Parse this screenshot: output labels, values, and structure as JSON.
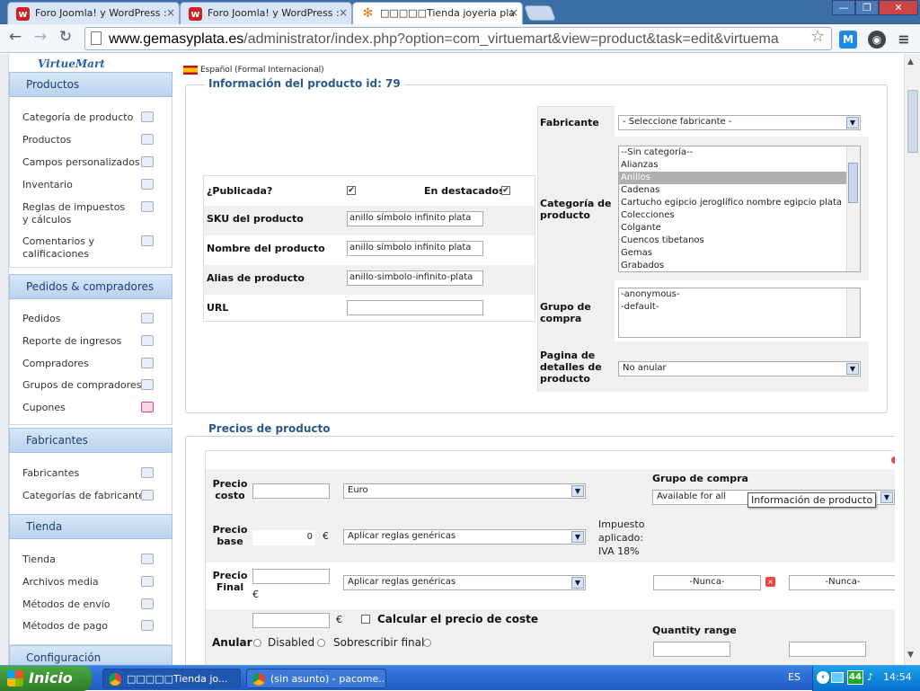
{
  "browser": {
    "tabs": [
      {
        "label": "Foro Joomla! y WordPress :",
        "icon": "w-favicon"
      },
      {
        "label": "Foro Joomla! y WordPress :",
        "icon": "w-favicon"
      },
      {
        "label": "□□□□□Tienda joyeria pla",
        "icon": "joomla-favicon"
      }
    ],
    "url_domain": "www.gemasyplata.es",
    "url_path": "/administrator/index.php?option=com_virtuemart&view=product&task=edit&virtuema"
  },
  "sidebar": {
    "logo": "VirtueMart",
    "sections": [
      {
        "title": "Productos",
        "items": [
          "Categoría de producto",
          "Productos",
          "Campos personalizados",
          "Inventario",
          "Reglas de impuestos y cálculos",
          "Comentarios y calificaciones"
        ]
      },
      {
        "title": "Pedidos & compradores",
        "items": [
          "Pedidos",
          "Reporte de ingresos",
          "Compradores",
          "Grupos de compradores",
          "Cupones"
        ]
      },
      {
        "title": "Fabricantes",
        "items": [
          "Fabricantes",
          "Categorías de fabricante"
        ]
      },
      {
        "title": "Tienda",
        "items": [
          "Tienda",
          "Archivos media",
          "Métodos de envío",
          "Métodos de pago"
        ]
      },
      {
        "title": "Configuración",
        "items": []
      }
    ]
  },
  "product": {
    "language": "Español (Formal Internacional)",
    "info_legend": "Información del producto id: 79",
    "published_label": "¿Publicada?",
    "published": true,
    "featured_label": "En destacados",
    "featured": true,
    "sku_label": "SKU del producto",
    "sku": "anillo símbolo infinito plata",
    "name_label": "Nombre del producto",
    "name": "anillo símbolo infinito plata",
    "alias_label": "Alias de producto",
    "alias": "anillo-simbolo-infinito-plata",
    "url_label": "URL",
    "url": "",
    "manufacturer_label": "Fabricante",
    "manufacturer": "- Seleccione fabricante -",
    "category_label": "Categoría de producto",
    "categories": [
      "--Sin categoría--",
      "Alianzas",
      "Anillos",
      "Cadenas",
      "Cartucho egipcio jeroglífico nombre egipcio plata",
      "Colecciones",
      "Colgante",
      "Cuencos tibetanos",
      "Gemas",
      "Grabados"
    ],
    "selected_category": "Anillos",
    "shopper_group_label": "Grupo de compra",
    "shopper_groups": [
      "-anonymous-",
      "-default-"
    ],
    "details_page_label": "Pagina de detalles de producto",
    "details_page": "No anular"
  },
  "prices": {
    "legend": "Precios de producto",
    "cost_label": "Precio costo",
    "cost_value": "",
    "currency": "Euro",
    "shopper_group_header": "Grupo de compra",
    "shopper_group_value": "Available for all",
    "tooltip": "Información de producto",
    "base_label": "Precio base",
    "base_value": "0",
    "euro_symbol": "€",
    "base_rule": "Aplicar reglas genéricas",
    "tax_text_1": "Impuesto",
    "tax_text_2": "aplicado:",
    "tax_text_3": "IVA 18%",
    "final_label": "Precio Final",
    "final_rule": "Aplicar reglas genéricas",
    "never_1": "-Nunca-",
    "never_2": "-Nunca-",
    "calc_cost_label": "Calcular el precio de coste",
    "override_label": "Anular",
    "disabled_label": "Disabled",
    "overwrite_label": "Sobrescribir final",
    "quantity_range_label": "Quantity range"
  },
  "taskbar": {
    "start": "Inicio",
    "tasks": [
      "□□□□□Tienda jo...",
      "(sin asunto) - pacome..."
    ],
    "lang": "ES",
    "badge": "44",
    "clock": "14:54"
  }
}
